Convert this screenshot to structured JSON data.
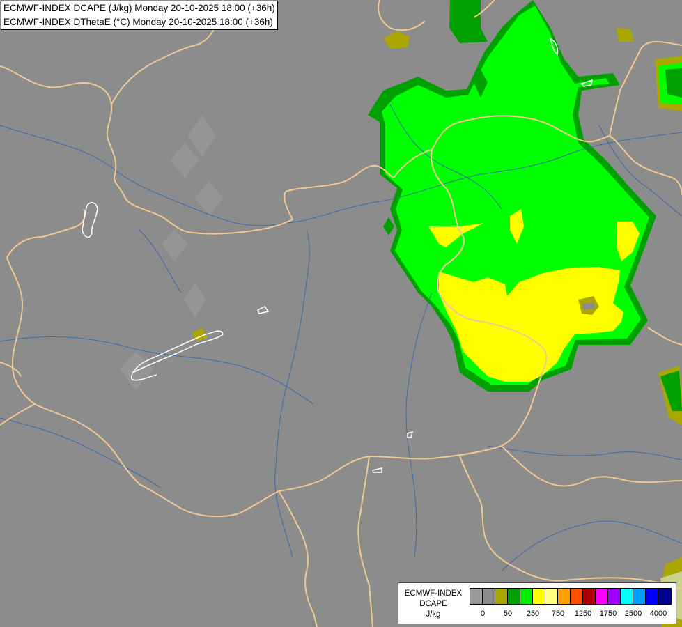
{
  "header": {
    "line1": "ECMWF-INDEX DCAPE (J/kg) Monday 20-10-2025 18:00 (+36h)",
    "line2": "ECMWF-INDEX DThetaE (°C) Monday 20-10-2025 18:00 (+36h)"
  },
  "legend": {
    "title_line1": "ECMWF-INDEX",
    "title_line2": "DCAPE",
    "title_line3": "J/kg",
    "colors": [
      "#9a9a9a",
      "#8c8c8c",
      "#aaa800",
      "#00a000",
      "#00f000",
      "#ffff00",
      "#ffff80",
      "#ffa000",
      "#ff5000",
      "#b00000",
      "#ff00ff",
      "#a000ff",
      "#00ffff",
      "#00a0ff",
      "#0000ff",
      "#000090"
    ],
    "ticks": [
      "0",
      "50",
      "250",
      "750",
      "1250",
      "1750",
      "2500",
      "4000"
    ]
  },
  "colors": {
    "background": "#8c8c8c",
    "borders": "#f0c896",
    "rivers": "#3a6aa8",
    "lakes": "#ffffff"
  }
}
